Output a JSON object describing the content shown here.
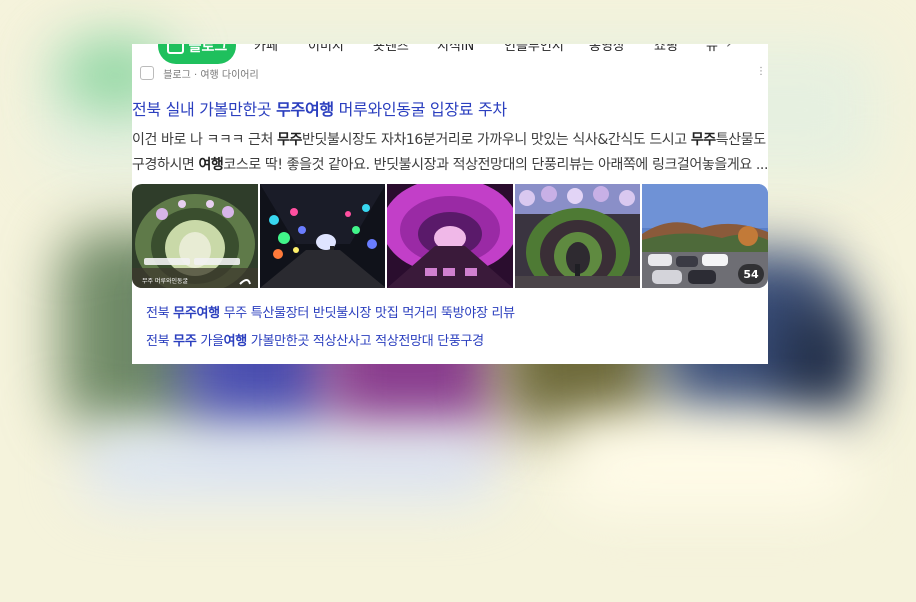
{
  "tabs": {
    "back": "‹",
    "active": "블로그",
    "items": [
      "카페",
      "이미지",
      "숏텐츠",
      "지식iN",
      "인플루언서",
      "동영상",
      "쇼핑",
      "뉴"
    ],
    "next": "›"
  },
  "source": {
    "text": "블로그 · 여행 다이어리",
    "more": "⋮"
  },
  "post": {
    "title_pre": "전북 실내 가볼만한곳 ",
    "title_bold": "무주여행",
    "title_post": " 머루와인동굴 입장료 주차",
    "desc_line1": {
      "a": "이건 바로 나 ㅋㅋㅋ 근처 ",
      "b": "무주",
      "c": "반딧불시장도 자차16분거리로 가까우니 맛있는 식사&간식도 드시고 ",
      "d": "무주",
      "e": "특산물도"
    },
    "desc_line2": {
      "a": "구경하시면 ",
      "b": "여행",
      "c": "코스로 딱! 좋을것 같아요. 반딧불시장과 적상전망대의 단풍리뷰는 아래쪽에 링크걸어놓을게요 ..."
    },
    "image_count": "54",
    "thumb1_caption": "무주 머루와인동굴"
  },
  "related": [
    {
      "a": "전북 ",
      "b": "무주여행",
      "c": " 무주 특산물장터 반딧불시장 맛집 먹거리 뚝방야장 리뷰"
    },
    {
      "a": "전북 ",
      "b": "무주",
      "c": " 가을",
      "d": "여행",
      "e": " 가볼만한곳 적상산사고 적상전망대 단풍구경"
    }
  ],
  "colors": {
    "accent_green": "#1fc05d",
    "link_blue": "#2b3fbf",
    "page_bg": "#f5f3dc"
  }
}
